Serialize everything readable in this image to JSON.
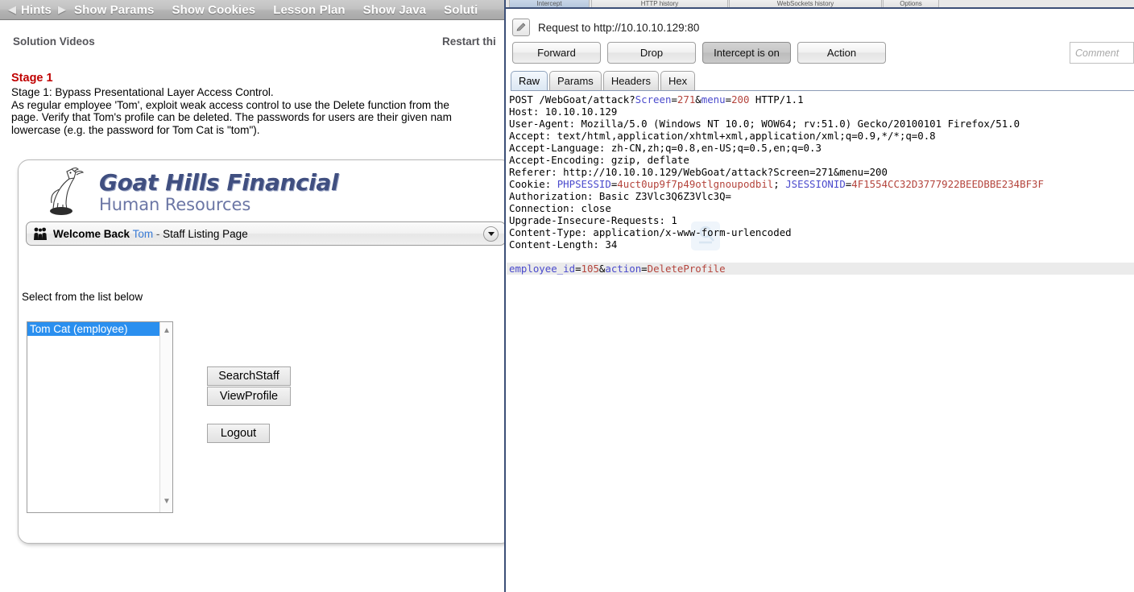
{
  "webgoat": {
    "nav": {
      "prev_icon": "left-triangle-icon",
      "next_icon": "right-triangle-icon",
      "items": [
        {
          "label": "Hints",
          "name": "nav-hints"
        },
        {
          "label": "Show Params",
          "name": "nav-show-params"
        },
        {
          "label": "Show Cookies",
          "name": "nav-show-cookies"
        },
        {
          "label": "Lesson Plan",
          "name": "nav-lesson-plan"
        },
        {
          "label": "Show Java",
          "name": "nav-show-java"
        },
        {
          "label": "Soluti",
          "name": "nav-solution"
        }
      ]
    },
    "subbar": {
      "solution_videos": "Solution Videos",
      "restart": "Restart thi"
    },
    "lesson": {
      "stage_heading": "Stage 1",
      "line1": "Stage 1: Bypass Presentational Layer Access Control.",
      "line2": "As regular employee 'Tom', exploit weak access control to use the Delete function from the",
      "line3": "page. Verify that Tom's profile can be deleted. The passwords for users are their given nam",
      "line4": "lowercase (e.g. the password for Tom Cat is \"tom\")."
    },
    "app": {
      "brand_line1": "Goat Hills Financial",
      "brand_line2": "Human Resources",
      "logo_icon": "goat-logo-icon",
      "welcome": {
        "people_icon": "people-icon",
        "prefix": "Welcome Back",
        "username": "Tom",
        "separator": "-",
        "page": "Staff Listing Page",
        "caret_icon": "chevron-down-icon"
      },
      "select_label": "Select from the list below",
      "staff_options": [
        {
          "label": "Tom Cat (employee)",
          "selected": true
        }
      ],
      "buttons": [
        {
          "label": "SearchStaff",
          "name": "search-staff-button"
        },
        {
          "label": "ViewProfile",
          "name": "view-profile-button"
        },
        {
          "label": "Logout",
          "name": "logout-button"
        }
      ]
    }
  },
  "burp": {
    "top_tabs": [
      {
        "label": "Intercept",
        "active": true
      },
      {
        "label": "HTTP history",
        "active": false
      },
      {
        "label": "WebSockets history",
        "active": false
      },
      {
        "label": "Options",
        "active": false
      }
    ],
    "request_label": "Request to http://10.10.10.129:80",
    "edit_icon": "pencil-icon",
    "actions": [
      {
        "label": "Forward",
        "name": "forward-button",
        "state": "normal"
      },
      {
        "label": "Drop",
        "name": "drop-button",
        "state": "normal"
      },
      {
        "label": "Intercept is on",
        "name": "intercept-toggle-button",
        "state": "pressed"
      },
      {
        "label": "Action",
        "name": "action-button",
        "state": "normal"
      }
    ],
    "comment_placeholder": "Comment",
    "comment_value": "",
    "view_tabs": [
      {
        "label": "Raw",
        "active": true
      },
      {
        "label": "Params",
        "active": false
      },
      {
        "label": "Headers",
        "active": false
      },
      {
        "label": "Hex",
        "active": false
      }
    ],
    "request": {
      "method": "POST",
      "path": "/WebGoat/attack?",
      "qs_key1": "Screen",
      "qs_val1": "271",
      "qs_amp": "&",
      "qs_key2": "menu",
      "qs_val2": "200",
      "http_version": " HTTP/1.1",
      "headers": [
        "Host: 10.10.10.129",
        "User-Agent: Mozilla/5.0 (Windows NT 10.0; WOW64; rv:51.0) Gecko/20100101 Firefox/51.0",
        "Accept: text/html,application/xhtml+xml,application/xml;q=0.9,*/*;q=0.8",
        "Accept-Language: zh-CN,zh;q=0.8,en-US;q=0.5,en;q=0.3",
        "Accept-Encoding: gzip, deflate",
        "Referer: http://10.10.10.129/WebGoat/attack?Screen=271&menu=200"
      ],
      "cookie_label": "Cookie: ",
      "cookie1_name": "PHPSESSID",
      "cookie1_value": "4uct0up9f7p49otlgnoupodbil",
      "cookie_sep": "; ",
      "cookie2_name": "JSESSIONID",
      "cookie2_value": "4F1554CC32D3777922BEEDBBE234BF3F",
      "headers_tail": [
        "Authorization: Basic Z3Vlc3Q6Z3Vlc3Q=",
        "Connection: close",
        "Upgrade-Insecure-Requests: 1",
        "Content-Type: application/x-www-form-urlencoded",
        "Content-Length: 34"
      ],
      "body_key1": "employee_id",
      "body_val1": "105",
      "body_amp": "&",
      "body_key2": "action",
      "body_val2": "DeleteProfile"
    },
    "watermark_icon": "burp-watermark-icon"
  },
  "colors": {
    "accent_blue": "#4a4acc",
    "value_red": "#b4443c",
    "stage_red": "#c00000",
    "selection_blue": "#2a8fef",
    "brand_blue": "#404f80",
    "panel_border": "#3c4f77"
  }
}
